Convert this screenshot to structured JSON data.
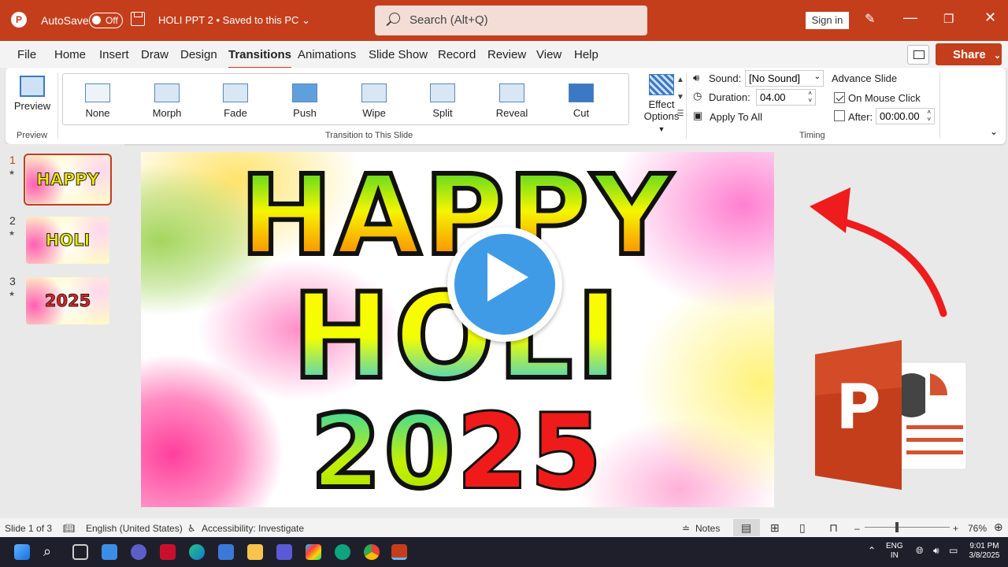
{
  "titlebar": {
    "autosave_label": "AutoSave",
    "autosave_state": "Off",
    "document_title": "HOLI PPT 2 • Saved to this PC",
    "search_placeholder": "Search (Alt+Q)",
    "sign_in": "Sign in"
  },
  "tabs": [
    "File",
    "Home",
    "Insert",
    "Draw",
    "Design",
    "Transitions",
    "Animations",
    "Slide Show",
    "Record",
    "Review",
    "View",
    "Help"
  ],
  "active_tab": "Transitions",
  "share_label": "Share",
  "ribbon": {
    "preview_label": "Preview",
    "preview_group": "Preview",
    "transitions": [
      "None",
      "Morph",
      "Fade",
      "Push",
      "Wipe",
      "Split",
      "Reveal",
      "Cut"
    ],
    "transition_group": "Transition to This Slide",
    "effect_options_line1": "Effect",
    "effect_options_line2": "Options",
    "sound_label": "Sound:",
    "sound_value": "[No Sound]",
    "duration_label": "Duration:",
    "duration_value": "04.00",
    "apply_to_all": "Apply To All",
    "advance_slide": "Advance Slide",
    "on_mouse_click": "On Mouse Click",
    "on_mouse_click_checked": true,
    "after_label": "After:",
    "after_value": "00:00.00",
    "after_checked": false,
    "timing_group": "Timing"
  },
  "slides": [
    {
      "number": "1",
      "text": "HAPPY",
      "selected": true
    },
    {
      "number": "2",
      "text": "HOLI",
      "selected": false
    },
    {
      "number": "3",
      "text": "2025",
      "selected": false
    }
  ],
  "slide_content": {
    "line1": "HAPPY",
    "line2": "HOLI",
    "line3a": "20",
    "line3b": "25"
  },
  "statusbar": {
    "slide_info": "Slide 1 of 3",
    "language": "English (United States)",
    "accessibility": "Accessibility: Investigate",
    "notes": "Notes",
    "zoom": "76%"
  },
  "taskbar": {
    "lang_line1": "ENG",
    "lang_line2": "IN",
    "time": "9:01 PM",
    "date": "3/8/2025"
  }
}
